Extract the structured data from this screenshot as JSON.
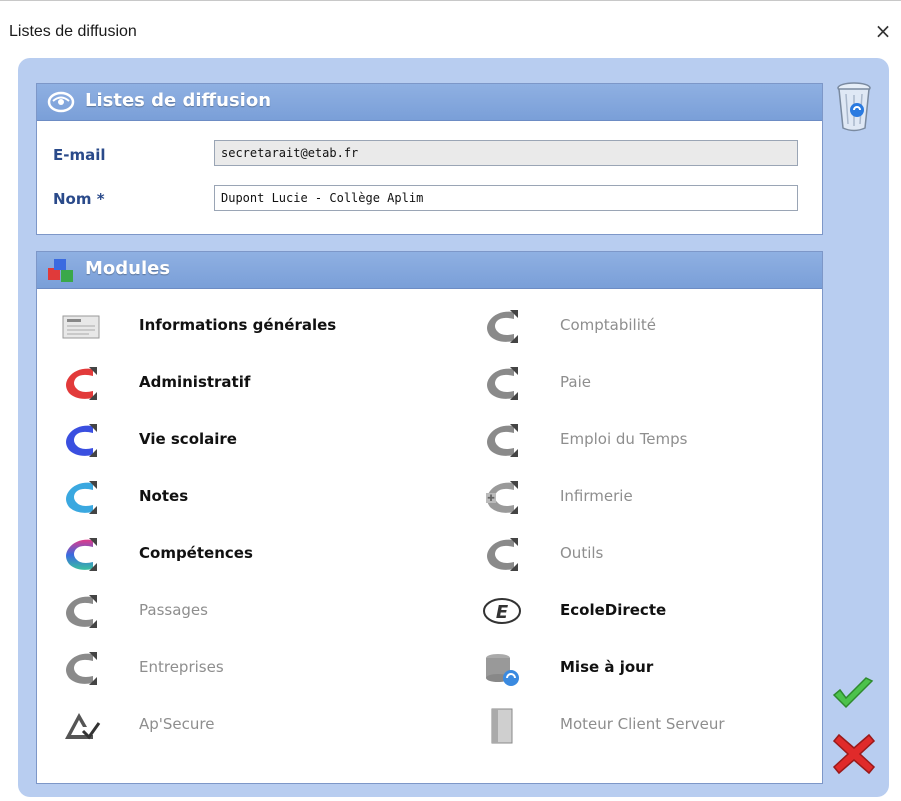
{
  "window": {
    "title": "Listes de diffusion",
    "close_glyph": "×"
  },
  "header": {
    "title": "Listes de diffusion",
    "icon": "mailing-list-icon"
  },
  "form": {
    "email_label": "E-mail",
    "email_value": "secretarait@etab.fr",
    "name_label": "Nom *",
    "name_value": "Dupont Lucie - Collège Aplim"
  },
  "modules_panel": {
    "title": "Modules",
    "icon": "modules-cubes-icon"
  },
  "modules_left": [
    {
      "label": "Informations générales",
      "active": true,
      "icon": "newspaper-icon"
    },
    {
      "label": "Administratif",
      "active": true,
      "icon": "c-red-icon"
    },
    {
      "label": "Vie scolaire",
      "active": true,
      "icon": "c-blue-icon"
    },
    {
      "label": "Notes",
      "active": true,
      "icon": "c-lightblue-icon"
    },
    {
      "label": "Compétences",
      "active": true,
      "icon": "c-multicolor-icon"
    },
    {
      "label": "Passages",
      "active": false,
      "icon": "c-gray-icon"
    },
    {
      "label": "Entreprises",
      "active": false,
      "icon": "c-gray-icon"
    },
    {
      "label": "Ap'Secure",
      "active": false,
      "icon": "apsecure-icon"
    }
  ],
  "modules_right": [
    {
      "label": "Comptabilité",
      "active": false,
      "icon": "c-gray-icon"
    },
    {
      "label": "Paie",
      "active": false,
      "icon": "c-gray-icon"
    },
    {
      "label": "Emploi du Temps",
      "active": false,
      "icon": "c-gray-icon"
    },
    {
      "label": "Infirmerie",
      "active": false,
      "icon": "c-gray-cross-icon"
    },
    {
      "label": "Outils",
      "active": false,
      "icon": "c-gray-icon"
    },
    {
      "label": "EcoleDirecte",
      "active": true,
      "icon": "ecoledirecte-icon"
    },
    {
      "label": "Mise à jour",
      "active": true,
      "icon": "database-update-icon"
    },
    {
      "label": "Moteur Client Serveur",
      "active": false,
      "icon": "server-icon"
    }
  ],
  "actions": {
    "delete": "trash-icon",
    "validate": "checkmark-icon",
    "cancel": "red-cross-icon"
  },
  "colors": {
    "dialog_bg": "#b8cdf0",
    "header_bg": "#7a9fd8",
    "label_blue": "#2a4a8a",
    "active_text": "#111111",
    "inactive_text": "#8e8e8e",
    "c_red": "#e23a3a",
    "c_blue": "#3a4fe0",
    "c_lightblue": "#3aa8e0",
    "c_gray": "#8a8a8a"
  }
}
